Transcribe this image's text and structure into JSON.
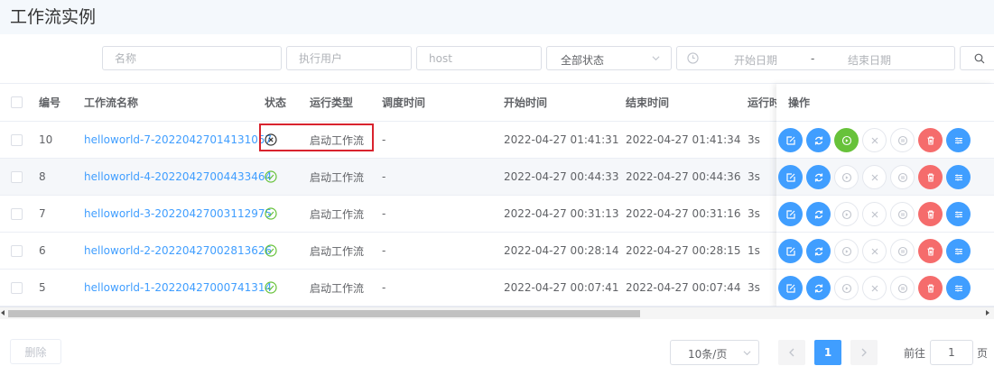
{
  "page": {
    "title": "工作流实例"
  },
  "filters": {
    "name_placeholder": "名称",
    "user_placeholder": "执行用户",
    "host_placeholder": "host",
    "status_value": "全部状态",
    "start_date_placeholder": "开始日期",
    "date_separator": "-",
    "end_date_placeholder": "结束日期"
  },
  "table": {
    "headers": {
      "num": "编号",
      "name": "工作流名称",
      "state": "状态",
      "run_type": "运行类型",
      "schedule_time": "调度时间",
      "start_time": "开始时间",
      "end_time": "结束时间",
      "run_time": "运行时",
      "ops": "操作"
    },
    "rows": [
      {
        "num": "10",
        "name": "helloworld-7-20220427014131057",
        "state": "stopped",
        "run_type": "启动工作流",
        "schedule_time": "-",
        "start_time": "2022-04-27 01:41:31",
        "end_time": "2022-04-27 01:41:34",
        "run_time": "3s"
      },
      {
        "num": "8",
        "name": "helloworld-4-20220427004433464",
        "state": "success",
        "run_type": "启动工作流",
        "schedule_time": "-",
        "start_time": "2022-04-27 00:44:33",
        "end_time": "2022-04-27 00:44:36",
        "run_time": "3s"
      },
      {
        "num": "7",
        "name": "helloworld-3-20220427003112975",
        "state": "success",
        "run_type": "启动工作流",
        "schedule_time": "-",
        "start_time": "2022-04-27 00:31:13",
        "end_time": "2022-04-27 00:31:16",
        "run_time": "3s"
      },
      {
        "num": "6",
        "name": "helloworld-2-20220427002813626",
        "state": "success",
        "run_type": "启动工作流",
        "schedule_time": "-",
        "start_time": "2022-04-27 00:28:14",
        "end_time": "2022-04-27 00:28:15",
        "run_time": "1s"
      },
      {
        "num": "5",
        "name": "helloworld-1-20220427000741314",
        "state": "success",
        "run_type": "启动工作流",
        "schedule_time": "-",
        "start_time": "2022-04-27 00:07:41",
        "end_time": "2022-04-27 00:07:44",
        "run_time": "3s"
      }
    ]
  },
  "footer": {
    "delete_label": "删除",
    "page_size": "10条/页",
    "current_page": "1",
    "goto_label": "前往",
    "goto_value": "1",
    "goto_suffix": "页"
  },
  "colors": {
    "primary": "#409eff",
    "success": "#67c23a",
    "danger": "#f56c6c",
    "highlight": "#d9232e"
  }
}
